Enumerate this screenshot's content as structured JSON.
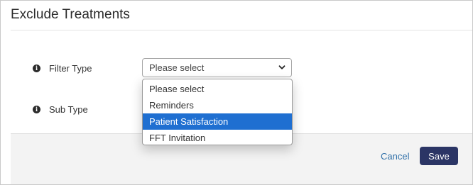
{
  "dialog": {
    "title": "Exclude Treatments"
  },
  "form": {
    "filter_type": {
      "label": "Filter Type",
      "value": "Please select"
    },
    "sub_type": {
      "label": "Sub Type"
    }
  },
  "dropdown": {
    "options": [
      "Please select",
      "Reminders",
      "Patient Satisfaction",
      "FFT Invitation"
    ],
    "highlighted": "Patient Satisfaction"
  },
  "footer": {
    "cancel_label": "Cancel",
    "save_label": "Save"
  },
  "icons": {
    "field_info": "info-icon",
    "select_arrow": "chevron-down-icon"
  },
  "colors": {
    "save_button": "#2b3565",
    "cancel_link": "#2f6fa8",
    "highlight": "#1f6fd1"
  }
}
